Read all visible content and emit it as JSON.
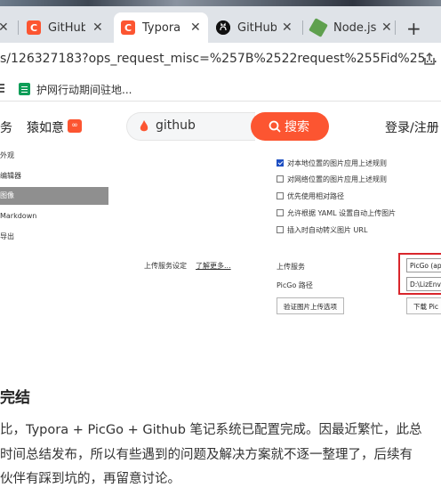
{
  "browser": {
    "tabs": [
      {
        "title": "GitHub",
        "icon": "csdn-icon"
      },
      {
        "title": "Typora",
        "icon": "csdn-icon",
        "active": true
      },
      {
        "title": "GitHub",
        "icon": "github-icon"
      },
      {
        "title": "Node.js",
        "icon": "nodejs-icon"
      }
    ],
    "close_glyph": "✕",
    "new_tab_glyph": "+",
    "url": "s/126327183?ops_request_misc=%257B%2522request%255Fid%25...",
    "bookmark_label": "护网行动期间驻地...",
    "accent": "#fc5531"
  },
  "header": {
    "nav_service": "务",
    "nav_yuanruyi": "猿如意",
    "badge": "∞",
    "search_value": "github",
    "search_button": "搜索",
    "login": "登录/注册"
  },
  "settings_shot": {
    "sidebar": [
      "外观",
      "编辑器",
      "图像",
      "Markdown",
      "导出"
    ],
    "options": [
      {
        "label": "对本地位置的图片应用上述规则",
        "checked": true
      },
      {
        "label": "对网络位置的图片应用上述规则",
        "checked": false
      },
      {
        "label": "优先使用相对路径",
        "checked": false
      },
      {
        "label": "允许根据 YAML 设置自动上传图片",
        "checked": false
      },
      {
        "label": "插入时自动转义图片 URL",
        "checked": false
      }
    ],
    "upload_settings_label": "上传服务设定",
    "learn_more": "了解更多...",
    "upload_service_label": "上传服务",
    "picgo_path_label": "PicGo 路径",
    "upload_service_value": "PicGo (ap",
    "picgo_path_value": "D:\\LizEnv\\",
    "verify_button": "验证图片上传选项",
    "download_button": "下载 Pic"
  },
  "article": {
    "heading": "完结",
    "lines": [
      "比，Typora + PicGo + Github 笔记系统已配置完成。因最近繁忙，此总",
      "时间总结发布，所以有些遇到的问题及解决方案就不逐一整理了，后续有",
      "伙伴有踩到坑的，再留意讨论。"
    ]
  }
}
